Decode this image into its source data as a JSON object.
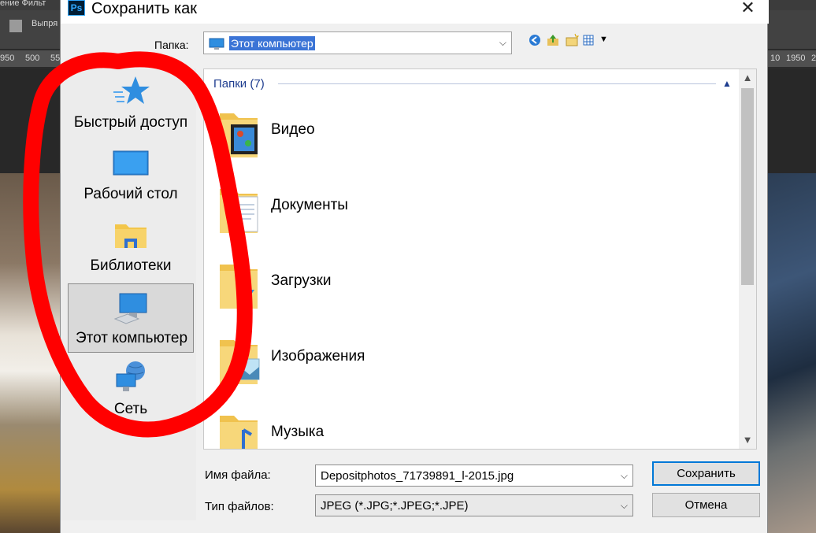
{
  "background": {
    "menu_partial": "ение   Фильт",
    "option_partial": "Выпря",
    "ruler_left": [
      "950",
      "500",
      "55"
    ],
    "ruler_right": [
      "10",
      "1950",
      "2"
    ]
  },
  "dialog": {
    "title": "Сохранить как",
    "app_icon_text": "Ps",
    "close_symbol": "✕",
    "folder_label": "Папка:",
    "folder_value": "Этот компьютер",
    "places": [
      {
        "label": "Быстрый доступ",
        "icon": "quick-access-star-icon"
      },
      {
        "label": "Рабочий стол",
        "icon": "desktop-icon"
      },
      {
        "label": "Библиотеки",
        "icon": "libraries-folder-icon"
      },
      {
        "label": "Этот компьютер",
        "icon": "this-pc-icon",
        "selected": true
      },
      {
        "label": "Сеть",
        "icon": "network-icon"
      }
    ],
    "group_header": "Папки (7)",
    "folders": [
      {
        "name": "Видео",
        "icon": "video-folder-icon"
      },
      {
        "name": "Документы",
        "icon": "documents-folder-icon"
      },
      {
        "name": "Загрузки",
        "icon": "downloads-folder-icon"
      },
      {
        "name": "Изображения",
        "icon": "pictures-folder-icon"
      },
      {
        "name": "Музыка",
        "icon": "music-folder-icon"
      }
    ],
    "filename_label": "Имя файла:",
    "filename_value": "Depositphotos_71739891_l-2015.jpg",
    "filetype_label": "Тип файлов:",
    "filetype_value": "JPEG (*.JPG;*.JPEG;*.JPE)",
    "save_button": "Сохранить",
    "cancel_button": "Отмена"
  },
  "colors": {
    "annotation": "#ff0000",
    "selection": "#3b74d6",
    "group_header": "#1e3d8f",
    "default_button_border": "#0078d7"
  }
}
